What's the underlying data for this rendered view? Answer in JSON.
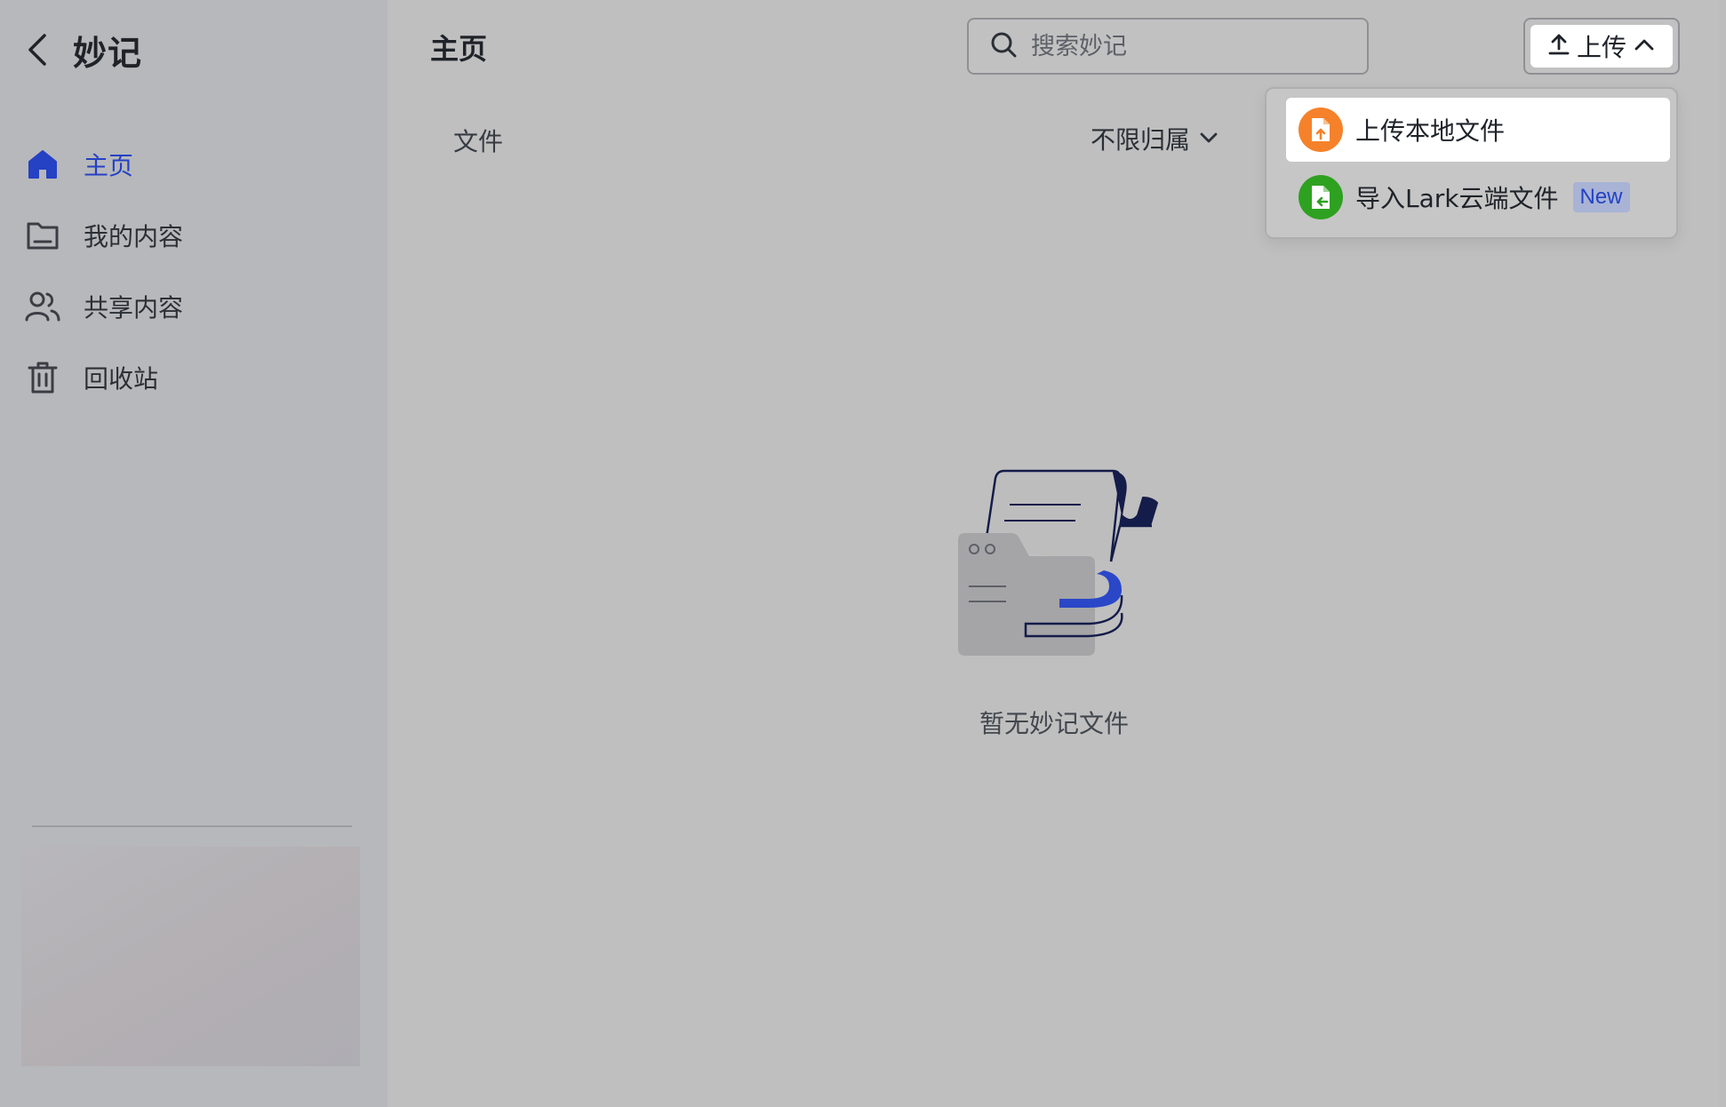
{
  "app": {
    "title": "妙记"
  },
  "sidebar": {
    "items": [
      {
        "label": "主页",
        "icon": "home-icon",
        "active": true
      },
      {
        "label": "我的内容",
        "icon": "folder-icon",
        "active": false
      },
      {
        "label": "共享内容",
        "icon": "people-icon",
        "active": false
      },
      {
        "label": "回收站",
        "icon": "trash-icon",
        "active": false
      }
    ]
  },
  "header": {
    "page_title": "主页",
    "search_placeholder": "搜索妙记",
    "upload_label": "上传"
  },
  "toolbar": {
    "files_label": "文件",
    "filter_label": "不限归属"
  },
  "upload_menu": {
    "items": [
      {
        "label": "上传本地文件",
        "icon": "file-upload-icon",
        "color": "#f5822a"
      },
      {
        "label": "导入Lark云端文件",
        "icon": "file-import-icon",
        "color": "#2ea121",
        "badge": "New"
      }
    ]
  },
  "empty_state": {
    "message": "暂无妙记文件"
  },
  "colors": {
    "accent": "#2541c4",
    "background": "#bfbfbf",
    "sidebar": "#b7b8bb"
  }
}
